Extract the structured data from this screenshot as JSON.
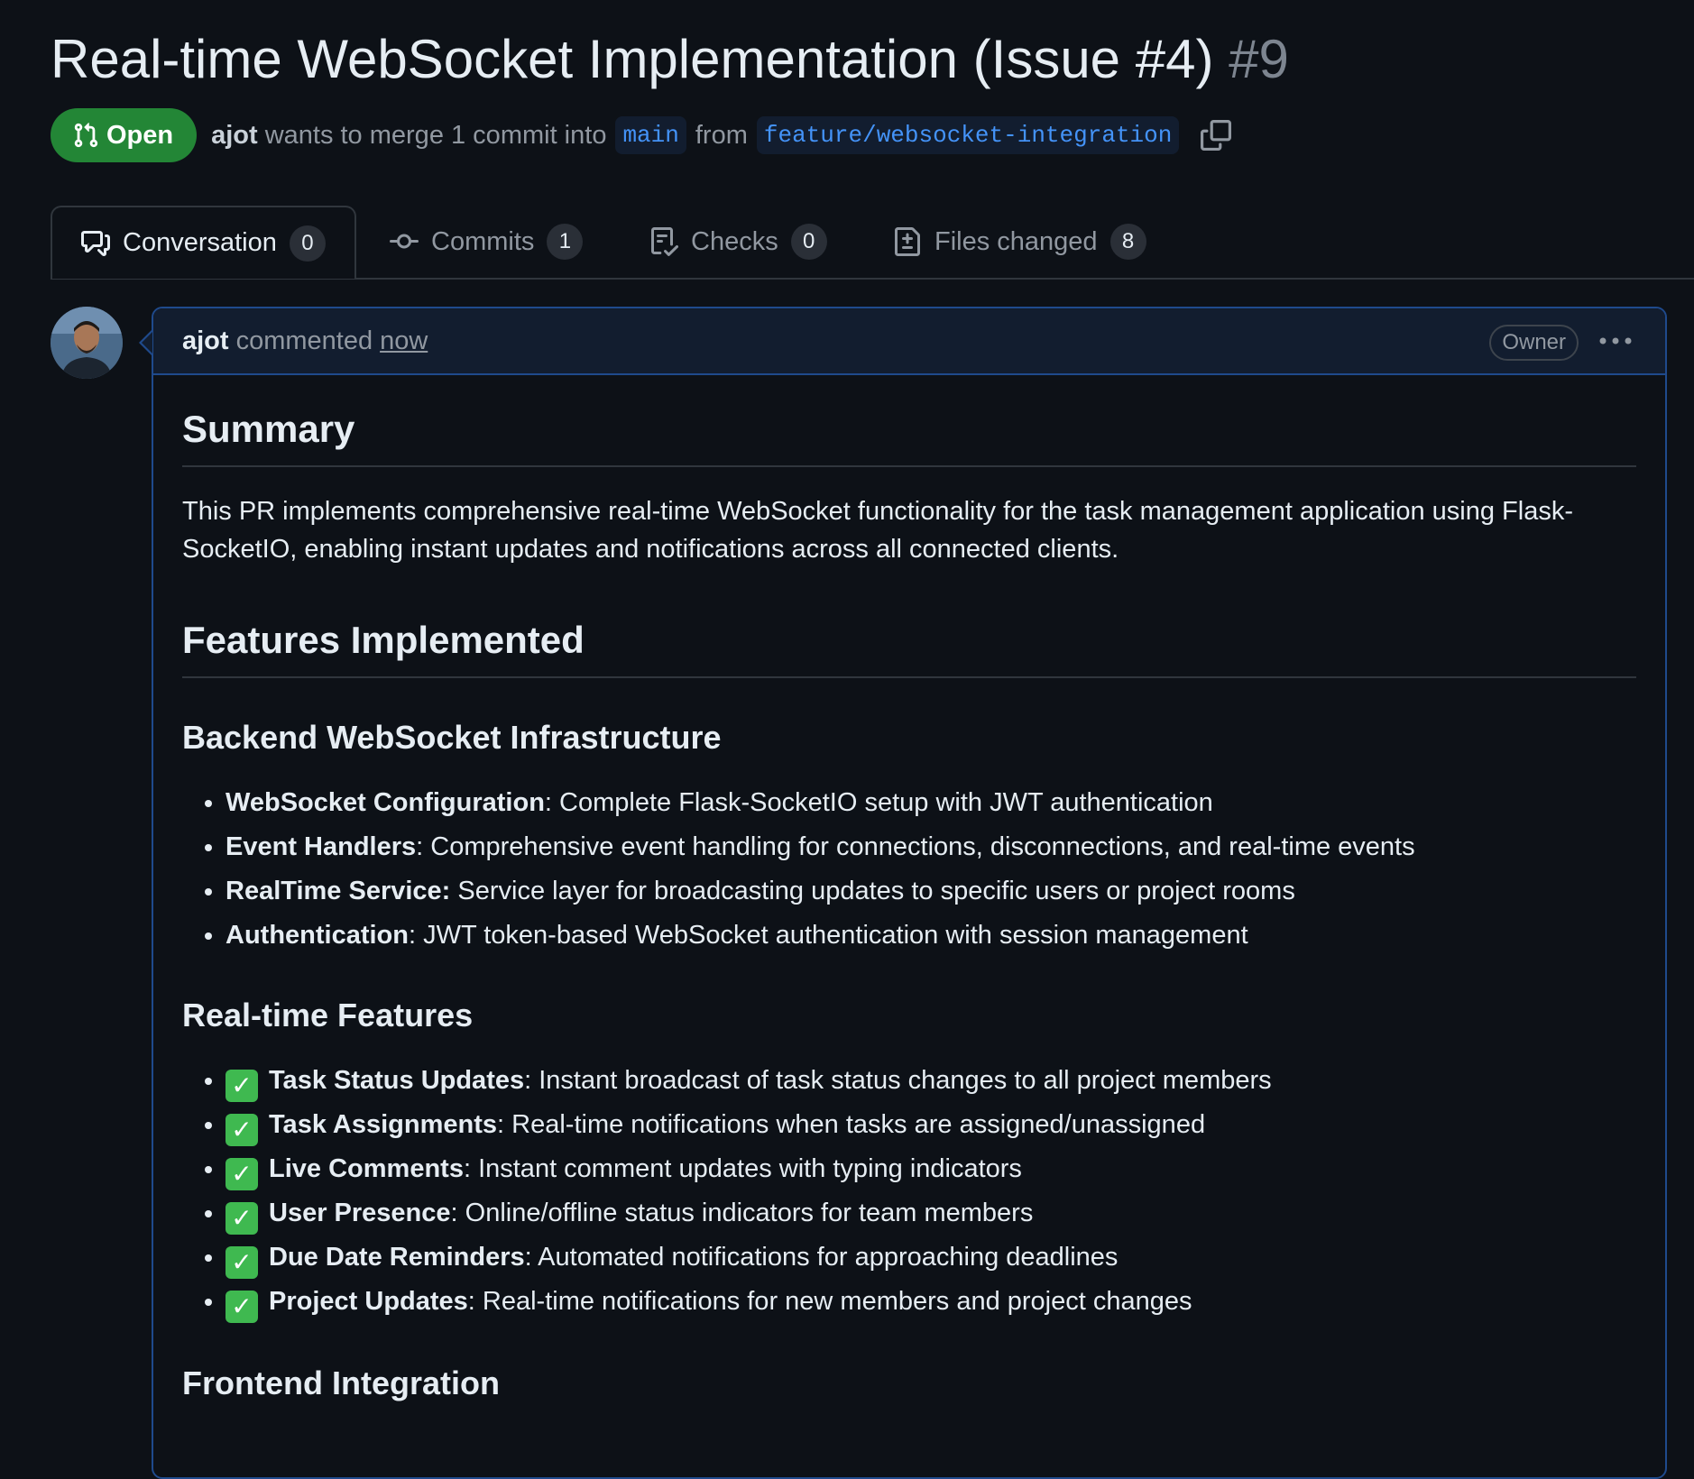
{
  "pr": {
    "title": "Real-time WebSocket Implementation (Issue #4)",
    "number": "#9",
    "state": "Open",
    "author": "ajot",
    "merge_text_1": "wants to merge 1 commit into",
    "base_branch": "main",
    "from_text": "from",
    "head_branch": "feature/websocket-integration"
  },
  "tabs": [
    {
      "label": "Conversation",
      "count": "0"
    },
    {
      "label": "Commits",
      "count": "1"
    },
    {
      "label": "Checks",
      "count": "0"
    },
    {
      "label": "Files changed",
      "count": "8"
    }
  ],
  "comment": {
    "author": "ajot",
    "action": "commented",
    "time": "now",
    "role": "Owner"
  },
  "body": {
    "summary_heading": "Summary",
    "summary_text": "This PR implements comprehensive real-time WebSocket functionality for the task management application using Flask-SocketIO, enabling instant updates and notifications across all connected clients.",
    "features_heading": "Features Implemented",
    "backend_heading": "Backend WebSocket Infrastructure",
    "backend_items": [
      {
        "bold": "WebSocket Configuration",
        "text": ": Complete Flask-SocketIO setup with JWT authentication"
      },
      {
        "bold": "Event Handlers",
        "text": ": Comprehensive event handling for connections, disconnections, and real-time events"
      },
      {
        "bold": "RealTime Service:",
        "text": " Service layer for broadcasting updates to specific users or project rooms"
      },
      {
        "bold": "Authentication",
        "text": ": JWT token-based WebSocket authentication with session management"
      }
    ],
    "realtime_heading": "Real-time Features",
    "check_glyph": "✓",
    "realtime_items": [
      {
        "bold": "Task Status Updates",
        "text": ": Instant broadcast of task status changes to all project members"
      },
      {
        "bold": "Task Assignments",
        "text": ": Real-time notifications when tasks are assigned/unassigned"
      },
      {
        "bold": "Live Comments",
        "text": ": Instant comment updates with typing indicators"
      },
      {
        "bold": "User Presence",
        "text": ": Online/offline status indicators for team members"
      },
      {
        "bold": "Due Date Reminders",
        "text": ": Automated notifications for approaching deadlines"
      },
      {
        "bold": "Project Updates",
        "text": ": Real-time notifications for new members and project changes"
      }
    ],
    "frontend_heading": "Frontend Integration"
  }
}
